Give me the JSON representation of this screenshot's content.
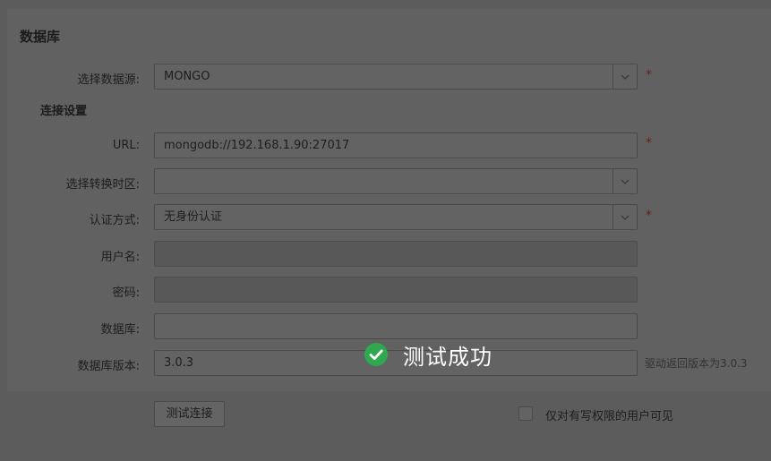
{
  "section": {
    "title": "数据库",
    "subtitle": "连接设置"
  },
  "fields": {
    "datasource": {
      "label": "选择数据源:",
      "value": "MONGO"
    },
    "url": {
      "label": "URL:",
      "value": "mongodb://192.168.1.90:27017"
    },
    "timezone": {
      "label": "选择转换时区:",
      "value": ""
    },
    "auth": {
      "label": "认证方式:",
      "value": "无身份认证"
    },
    "username": {
      "label": "用户名:",
      "value": ""
    },
    "password": {
      "label": "密码:",
      "value": ""
    },
    "database": {
      "label": "数据库:",
      "value": ""
    },
    "version": {
      "label": "数据库版本:",
      "value": "3.0.3",
      "hint": "驱动返回版本为3.0.3"
    }
  },
  "required_mark": "*",
  "actions": {
    "test_button": "测试连接",
    "owner_only_label": "仅对有写权限的用户可见"
  },
  "toast": {
    "message": "测试成功",
    "icon": "check-circle-icon",
    "color": "#2fa84f"
  },
  "colors": {
    "overlay": "#5c5c5c",
    "required": "#6b1e1a"
  }
}
